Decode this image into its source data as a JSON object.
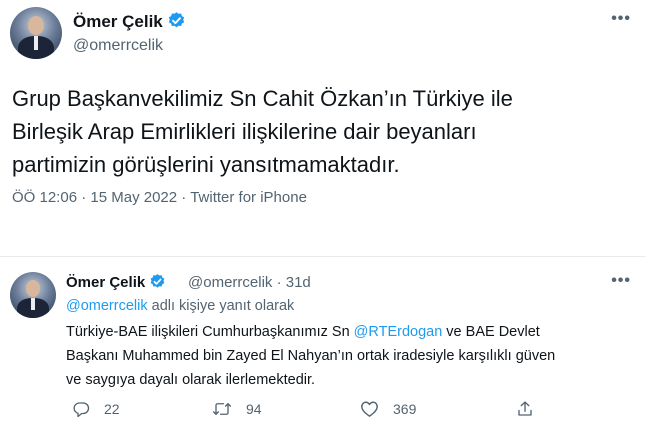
{
  "main_tweet": {
    "author_name": "Ömer Çelik",
    "handle": "@omerrcelik",
    "text_lines": [
      "Grup Başkanvekilimiz Sn Cahit Özkan’ın Türkiye ile",
      "Birleşik Arap Emirlikleri ilişkilerine dair beyanları",
      "partimizin görüşlerini yansıtmamaktadır."
    ],
    "time": "ÖÖ 12:06",
    "date": "15 May 2022",
    "source": "Twitter for iPhone",
    "separator": "·",
    "more_icon": "•••"
  },
  "reply_tweet": {
    "author_name": "Ömer Çelik",
    "handle": "@omerrcelik",
    "age": "31d",
    "separator": "·",
    "more_icon": "•••",
    "reply_to_handle": "@omerrcelik",
    "reply_to_text": "adlı kişiye yanıt olarak",
    "text_part1": "Türkiye-BAE ilişkileri Cumhurbaşkanımız Sn ",
    "mention": "@RTErdogan",
    "text_part2": " ve BAE Devlet",
    "text_line2": "Başkanı Muhammed bin Zayed El Nahyan’ın ortak iradesiyle karşılıklı güven",
    "text_line3": "ve saygıya dayalı olarak ilerlemektedir.",
    "replies": "22",
    "retweets": "94",
    "likes": "369"
  },
  "colors": {
    "link": "#1d9bf0",
    "muted": "#536471",
    "text": "#0f1419",
    "verified": "#1d9bf0"
  },
  "icons": {
    "reply": "reply-icon",
    "retweet": "retweet-icon",
    "like": "heart-icon",
    "share": "share-icon",
    "verified": "verified-badge-icon"
  }
}
